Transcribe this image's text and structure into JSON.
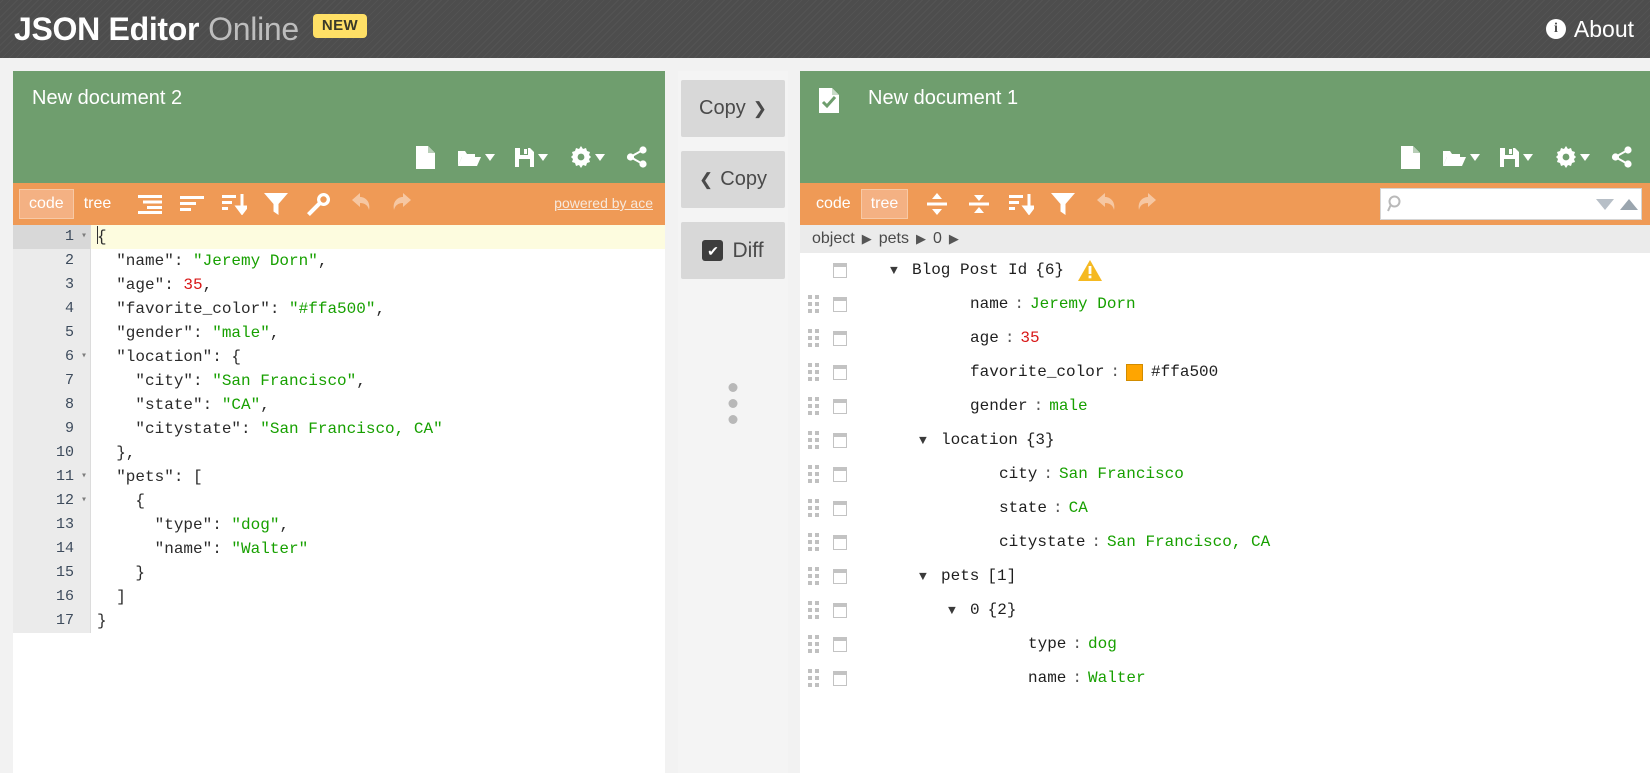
{
  "header": {
    "brand_bold": "JSON Editor",
    "brand_light": "Online",
    "badge": "NEW",
    "about": "About",
    "info_glyph": "i",
    "bg_color": "#4d4d4d"
  },
  "left_panel": {
    "title": "New document 2",
    "header_color": "#6f9e6e",
    "menubar_color": "#ef9a56",
    "header_tools": [
      {
        "name": "new-document-icon",
        "caret": false
      },
      {
        "name": "open-folder-icon",
        "caret": true
      },
      {
        "name": "save-icon",
        "caret": true
      },
      {
        "name": "settings-gear-icon",
        "caret": true
      },
      {
        "name": "share-icon",
        "caret": false
      }
    ],
    "modes": [
      {
        "label": "code",
        "active": true
      },
      {
        "label": "tree",
        "active": false
      }
    ],
    "tools": [
      {
        "name": "compact-icon",
        "disabled": false
      },
      {
        "name": "format-icon",
        "disabled": false
      },
      {
        "name": "sort-icon",
        "disabled": false
      },
      {
        "name": "filter-icon",
        "disabled": false
      },
      {
        "name": "transform-wrench-icon",
        "disabled": false
      },
      {
        "name": "undo-icon",
        "disabled": true
      },
      {
        "name": "redo-icon",
        "disabled": true
      }
    ],
    "powered_by": "powered by ace"
  },
  "code_lines": [
    {
      "num": "1",
      "fold": true,
      "highlight": true,
      "tokens": [
        {
          "t": "caret"
        },
        {
          "t": "p",
          "v": "{"
        }
      ]
    },
    {
      "num": "2",
      "fold": false,
      "highlight": false,
      "tokens": [
        {
          "t": "k",
          "v": "  \"name\""
        },
        {
          "t": "p",
          "v": ": "
        },
        {
          "t": "s",
          "v": "\"Jeremy Dorn\""
        },
        {
          "t": "p",
          "v": ","
        }
      ]
    },
    {
      "num": "3",
      "fold": false,
      "highlight": false,
      "tokens": [
        {
          "t": "k",
          "v": "  \"age\""
        },
        {
          "t": "p",
          "v": ": "
        },
        {
          "t": "n",
          "v": "35"
        },
        {
          "t": "p",
          "v": ","
        }
      ]
    },
    {
      "num": "4",
      "fold": false,
      "highlight": false,
      "tokens": [
        {
          "t": "k",
          "v": "  \"favorite_color\""
        },
        {
          "t": "p",
          "v": ": "
        },
        {
          "t": "s",
          "v": "\"#ffa500\""
        },
        {
          "t": "p",
          "v": ","
        }
      ]
    },
    {
      "num": "5",
      "fold": false,
      "highlight": false,
      "tokens": [
        {
          "t": "k",
          "v": "  \"gender\""
        },
        {
          "t": "p",
          "v": ": "
        },
        {
          "t": "s",
          "v": "\"male\""
        },
        {
          "t": "p",
          "v": ","
        }
      ]
    },
    {
      "num": "6",
      "fold": true,
      "highlight": false,
      "tokens": [
        {
          "t": "k",
          "v": "  \"location\""
        },
        {
          "t": "p",
          "v": ": {"
        }
      ]
    },
    {
      "num": "7",
      "fold": false,
      "highlight": false,
      "tokens": [
        {
          "t": "k",
          "v": "    \"city\""
        },
        {
          "t": "p",
          "v": ": "
        },
        {
          "t": "s",
          "v": "\"San Francisco\""
        },
        {
          "t": "p",
          "v": ","
        }
      ]
    },
    {
      "num": "8",
      "fold": false,
      "highlight": false,
      "tokens": [
        {
          "t": "k",
          "v": "    \"state\""
        },
        {
          "t": "p",
          "v": ": "
        },
        {
          "t": "s",
          "v": "\"CA\""
        },
        {
          "t": "p",
          "v": ","
        }
      ]
    },
    {
      "num": "9",
      "fold": false,
      "highlight": false,
      "tokens": [
        {
          "t": "k",
          "v": "    \"citystate\""
        },
        {
          "t": "p",
          "v": ": "
        },
        {
          "t": "s",
          "v": "\"San Francisco, CA\""
        }
      ]
    },
    {
      "num": "10",
      "fold": false,
      "highlight": false,
      "tokens": [
        {
          "t": "p",
          "v": "  },"
        }
      ]
    },
    {
      "num": "11",
      "fold": true,
      "highlight": false,
      "tokens": [
        {
          "t": "k",
          "v": "  \"pets\""
        },
        {
          "t": "p",
          "v": ": ["
        }
      ]
    },
    {
      "num": "12",
      "fold": true,
      "highlight": false,
      "tokens": [
        {
          "t": "p",
          "v": "    {"
        }
      ]
    },
    {
      "num": "13",
      "fold": false,
      "highlight": false,
      "tokens": [
        {
          "t": "k",
          "v": "      \"type\""
        },
        {
          "t": "p",
          "v": ": "
        },
        {
          "t": "s",
          "v": "\"dog\""
        },
        {
          "t": "p",
          "v": ","
        }
      ]
    },
    {
      "num": "14",
      "fold": false,
      "highlight": false,
      "tokens": [
        {
          "t": "k",
          "v": "      \"name\""
        },
        {
          "t": "p",
          "v": ": "
        },
        {
          "t": "s",
          "v": "\"Walter\""
        }
      ]
    },
    {
      "num": "15",
      "fold": false,
      "highlight": false,
      "tokens": [
        {
          "t": "p",
          "v": "    }"
        }
      ]
    },
    {
      "num": "16",
      "fold": false,
      "highlight": false,
      "tokens": [
        {
          "t": "p",
          "v": "  ]"
        }
      ]
    },
    {
      "num": "17",
      "fold": false,
      "highlight": false,
      "tokens": [
        {
          "t": "p",
          "v": "}"
        }
      ]
    }
  ],
  "middle": {
    "copy_right_label": "Copy",
    "copy_right_chevron": "❯",
    "copy_left_label": "Copy",
    "copy_left_chevron": "❮",
    "diff_label": "Diff",
    "diff_checked": true,
    "diff_check_glyph": "✔"
  },
  "right_panel": {
    "title": "New document 1",
    "doc_icon": "document-check-icon",
    "header_tools": [
      {
        "name": "new-document-icon",
        "caret": false
      },
      {
        "name": "open-folder-icon",
        "caret": true
      },
      {
        "name": "save-icon",
        "caret": true
      },
      {
        "name": "settings-gear-icon",
        "caret": true
      },
      {
        "name": "share-icon",
        "caret": false
      }
    ],
    "modes": [
      {
        "label": "code",
        "active": false
      },
      {
        "label": "tree",
        "active": true
      }
    ],
    "tools": [
      {
        "name": "expand-all-icon",
        "disabled": false
      },
      {
        "name": "collapse-all-icon",
        "disabled": false
      },
      {
        "name": "sort-icon",
        "disabled": false
      },
      {
        "name": "filter-icon",
        "disabled": false
      },
      {
        "name": "undo-icon",
        "disabled": true
      },
      {
        "name": "redo-icon",
        "disabled": true
      }
    ],
    "search_placeholder": "",
    "search_value": "",
    "breadcrumb": [
      "object",
      "pets",
      "0"
    ],
    "breadcrumb_arrow": "▶"
  },
  "tree_rows": [
    {
      "grip": false,
      "indent": 0,
      "expander": "▼",
      "key": "Blog Post Id",
      "sep": "",
      "value": "",
      "vtype": "none",
      "count": "{6}",
      "warning": true,
      "swatch": ""
    },
    {
      "grip": true,
      "indent": 2,
      "expander": "",
      "key": "name",
      "sep": ":",
      "value": "Jeremy Dorn",
      "vtype": "str",
      "count": "",
      "warning": false,
      "swatch": ""
    },
    {
      "grip": true,
      "indent": 2,
      "expander": "",
      "key": "age  ",
      "sep": ":",
      "value": "35",
      "vtype": "num",
      "count": "",
      "warning": false,
      "swatch": ""
    },
    {
      "grip": true,
      "indent": 2,
      "expander": "",
      "key": "favorite_color",
      "sep": ":",
      "value": "#ffa500",
      "vtype": "plain",
      "count": "",
      "warning": false,
      "swatch": "#ffa500"
    },
    {
      "grip": true,
      "indent": 2,
      "expander": "",
      "key": "gender",
      "sep": ":",
      "value": "male",
      "vtype": "str",
      "count": "",
      "warning": false,
      "swatch": ""
    },
    {
      "grip": true,
      "indent": 1,
      "expander": "▼",
      "key": "location",
      "sep": "",
      "value": "",
      "vtype": "none",
      "count": "{3}",
      "warning": false,
      "swatch": ""
    },
    {
      "grip": true,
      "indent": 3,
      "expander": "",
      "key": "city ",
      "sep": ":",
      "value": "San Francisco",
      "vtype": "str",
      "count": "",
      "warning": false,
      "swatch": ""
    },
    {
      "grip": true,
      "indent": 3,
      "expander": "",
      "key": "state",
      "sep": ":",
      "value": "CA",
      "vtype": "str",
      "count": "",
      "warning": false,
      "swatch": ""
    },
    {
      "grip": true,
      "indent": 3,
      "expander": "",
      "key": "citystate",
      "sep": ":",
      "value": "San Francisco, CA",
      "vtype": "str",
      "count": "",
      "warning": false,
      "swatch": ""
    },
    {
      "grip": true,
      "indent": 1,
      "expander": "▼",
      "key": "pets",
      "sep": "",
      "value": "",
      "vtype": "none",
      "count": "[1]",
      "warning": false,
      "swatch": ""
    },
    {
      "grip": true,
      "indent": 2,
      "expander": "▼",
      "key": "0",
      "sep": "",
      "value": "",
      "vtype": "none",
      "count": "{2}",
      "warning": false,
      "swatch": ""
    },
    {
      "grip": true,
      "indent": 4,
      "expander": "",
      "key": "type",
      "sep": ":",
      "value": "dog",
      "vtype": "str",
      "count": "",
      "warning": false,
      "swatch": ""
    },
    {
      "grip": true,
      "indent": 4,
      "expander": "",
      "key": "name",
      "sep": ":",
      "value": "Walter",
      "vtype": "str",
      "count": "",
      "warning": false,
      "swatch": ""
    }
  ]
}
